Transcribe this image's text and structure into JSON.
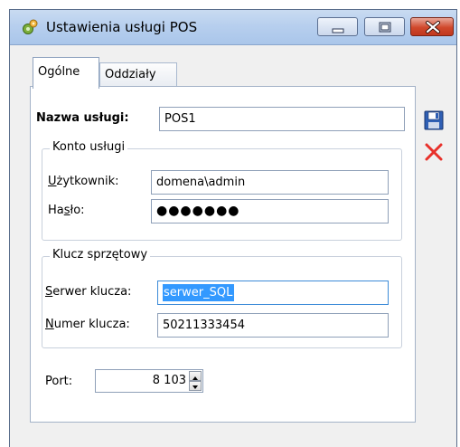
{
  "window": {
    "title": "Ustawienia usługi POS"
  },
  "tabs": [
    {
      "label": "Ogólne",
      "active": true
    },
    {
      "label": "Oddziały",
      "active": false
    }
  ],
  "form": {
    "service_name_label": "Nazwa usługi:",
    "service_name_value": "POS1",
    "account_group": {
      "title": "Konto usługi",
      "user_label_first": "U",
      "user_label_rest": "żytkownik:",
      "user_value": "domena\\admin",
      "password_label_first": "Ha",
      "password_label_underlined": "s",
      "password_label_rest": "ło:",
      "password_value": "●●●●●●●"
    },
    "key_group": {
      "title": "Klucz sprzętowy",
      "server_label_first": "S",
      "server_label_rest": "erwer klucza:",
      "server_value": "serwer_SQL",
      "number_label_first": "N",
      "number_label_rest": "umer klucza:",
      "number_value": "50211333454"
    },
    "port_label": "Port:",
    "port_value": "8 103"
  },
  "icons": {
    "save": "floppy-disk-icon",
    "delete": "red-x-icon",
    "app": "gears-icon"
  },
  "colors": {
    "selection": "#3399ff",
    "delete_red": "#e8302a",
    "save_blue": "#2f5fb4"
  }
}
